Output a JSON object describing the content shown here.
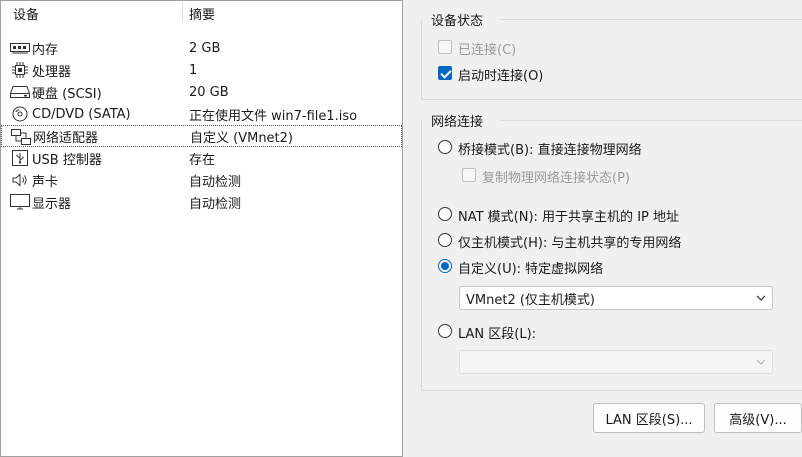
{
  "devices": {
    "header": {
      "device": "设备",
      "summary": "摘要"
    },
    "items": [
      {
        "icon": "memory-icon",
        "name": "内存",
        "summary": "2 GB"
      },
      {
        "icon": "cpu-icon",
        "name": "处理器",
        "summary": "1"
      },
      {
        "icon": "harddisk-icon",
        "name": "硬盘 (SCSI)",
        "summary": "20 GB"
      },
      {
        "icon": "cd-dvd-icon",
        "name": "CD/DVD (SATA)",
        "summary": "正在使用文件 win7-file1.iso"
      },
      {
        "icon": "network-adapter-icon",
        "name": "网络适配器",
        "summary": "自定义 (VMnet2)"
      },
      {
        "icon": "usb-icon",
        "name": "USB 控制器",
        "summary": "存在"
      },
      {
        "icon": "sound-icon",
        "name": "声卡",
        "summary": "自动检测"
      },
      {
        "icon": "display-icon",
        "name": "显示器",
        "summary": "自动检测"
      }
    ]
  },
  "device_status": {
    "title": "设备状态",
    "connected": {
      "label": "已连接(C)",
      "checked": false,
      "disabled": true
    },
    "connect_on_start": {
      "label": "启动时连接(O)",
      "checked": true
    }
  },
  "network": {
    "title": "网络连接",
    "bridged": {
      "label": "桥接模式(B): 直接连接物理网络"
    },
    "replicate": {
      "label": "复制物理网络连接状态(P)"
    },
    "nat": {
      "label": "NAT 模式(N): 用于共享主机的 IP 地址"
    },
    "host_only": {
      "label": "仅主机模式(H): 与主机共享的专用网络"
    },
    "custom": {
      "label": "自定义(U): 特定虚拟网络",
      "selected": true
    },
    "custom_value": "VMnet2 (仅主机模式)",
    "lan_segment": {
      "label": "LAN 区段(L):"
    },
    "lan_segment_value": ""
  },
  "buttons": {
    "lan_segments": "LAN 区段(S)...",
    "advanced": "高级(V)..."
  },
  "colors": {
    "accent": "#0067c0"
  }
}
